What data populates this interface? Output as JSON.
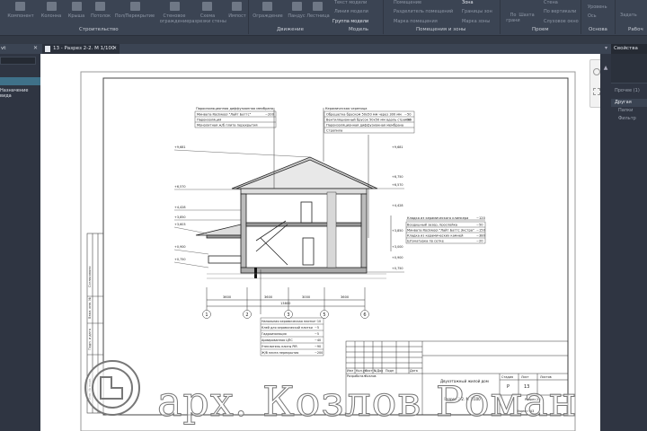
{
  "ribbon": {
    "tools": [
      "Компонент",
      "Колонна",
      "Крыша",
      "Потолок",
      "Пол/Перекрытие",
      "Стеновое ограждение",
      "Схема разрезки стены",
      "Импост",
      "Ограждение",
      "Пандус",
      "Лестница"
    ],
    "model_tools": [
      "Текст модели",
      "Линия модели",
      "Группа модели"
    ],
    "room_tools": [
      "Помещение",
      "Разделитель помещений",
      "Марка помещения",
      "Зона",
      "Границы зон",
      "Марка зоны"
    ],
    "opening_tools": [
      "По грани",
      "Шахта",
      "Стена",
      "По вертикали",
      "Слуховое окно"
    ],
    "datum_tools": [
      "Уровень",
      "Ось"
    ],
    "work_tools": [
      "Задать"
    ],
    "groups": [
      "Строительство",
      "Движение",
      "Модель",
      "Помещения и зоны",
      "Проем",
      "Основа",
      "Рабоч"
    ]
  },
  "left_panel": {
    "title": "vt",
    "item": "Назначение вида"
  },
  "tab": {
    "label": "13 - Разрез 2-2. М 1/100"
  },
  "properties": {
    "title": "Свойства",
    "other": "Прочее (1)",
    "category": "Другая",
    "rows": [
      "Папки",
      "Фильтр"
    ]
  },
  "drawing": {
    "notes_left_top": {
      "title": "Пароизоляционная диффузионная мембрана",
      "rows": [
        [
          "Минвата Rockwool \"Лайт Баттс\"",
          "~200"
        ],
        [
          "Пароизоляция",
          ""
        ],
        [
          "Монолитная ж/б плита перекрытия",
          ""
        ]
      ]
    },
    "notes_right_top": {
      "title": "Керамическая черепица",
      "rows": [
        [
          "Обрешетка бруском 50х50 мм через 300 мм",
          "~50"
        ],
        [
          "Вентиляционный брусок 50х50 мм вдоль стропил",
          "~50"
        ],
        [
          "Пароизоляционная диффузионная мембрана",
          ""
        ],
        [
          "Стропила",
          ""
        ]
      ]
    },
    "notes_wall": {
      "rows": [
        [
          "Кладка из керамического клинкера",
          "~120"
        ],
        [
          "Воздушный зазор, прослойка",
          "~50"
        ],
        [
          "Минвата Rockwool \"Лайт Баттс Экстра\"",
          "~150"
        ],
        [
          "Кладка из керамических камней",
          "~380"
        ],
        [
          "Штукатурка по сетке",
          "~20"
        ]
      ]
    },
    "notes_floor": {
      "rows": [
        [
          "Напольная керамическая плитка",
          "~10"
        ],
        [
          "Клей для керамической плитки",
          "~5"
        ],
        [
          "Гидроизоляция",
          "~5"
        ],
        [
          "Армированная ЦПС",
          "~40"
        ],
        [
          "Утеплитель плиты PIR",
          "~90"
        ],
        [
          "Ж/б плита перекрытия",
          "~200"
        ]
      ]
    },
    "levels_left": [
      "+9,681",
      "+6,570",
      "+4,428",
      "+3,850",
      "+3,603",
      "+0,900",
      "+0,750"
    ],
    "levels_right": [
      "+9,681",
      "+6,750",
      "+6,570",
      "+4,428",
      "+3,850",
      "+3,000",
      "+0,900",
      "+0,750"
    ],
    "dims": [
      "3600",
      "3600",
      "3000",
      "3600"
    ],
    "dim_total": "13800",
    "axes": [
      "1",
      "2",
      "3",
      "5",
      "6"
    ],
    "title_block": {
      "headers": [
        "Изм",
        "Кол.уч",
        "Лист",
        "№Док",
        "Подп",
        "Дата"
      ],
      "developer": [
        "Разработал",
        "Козлов"
      ],
      "building": "Двухэтажный жилой дом",
      "sheet_name": "Разрез 2-2. М 1/100",
      "stage_h": "Стадия",
      "sheet_h": "Лист",
      "sheets_h": "Листов",
      "stage": "P",
      "sheet": "13",
      "section": "Разрез 2-2",
      "format": "Формат А3"
    },
    "side_stamp": [
      "Согласовано",
      "Взам. инв. №",
      "Подп. и дата",
      "Инв. № подл."
    ]
  },
  "watermark": "арх. Козлов Роман"
}
